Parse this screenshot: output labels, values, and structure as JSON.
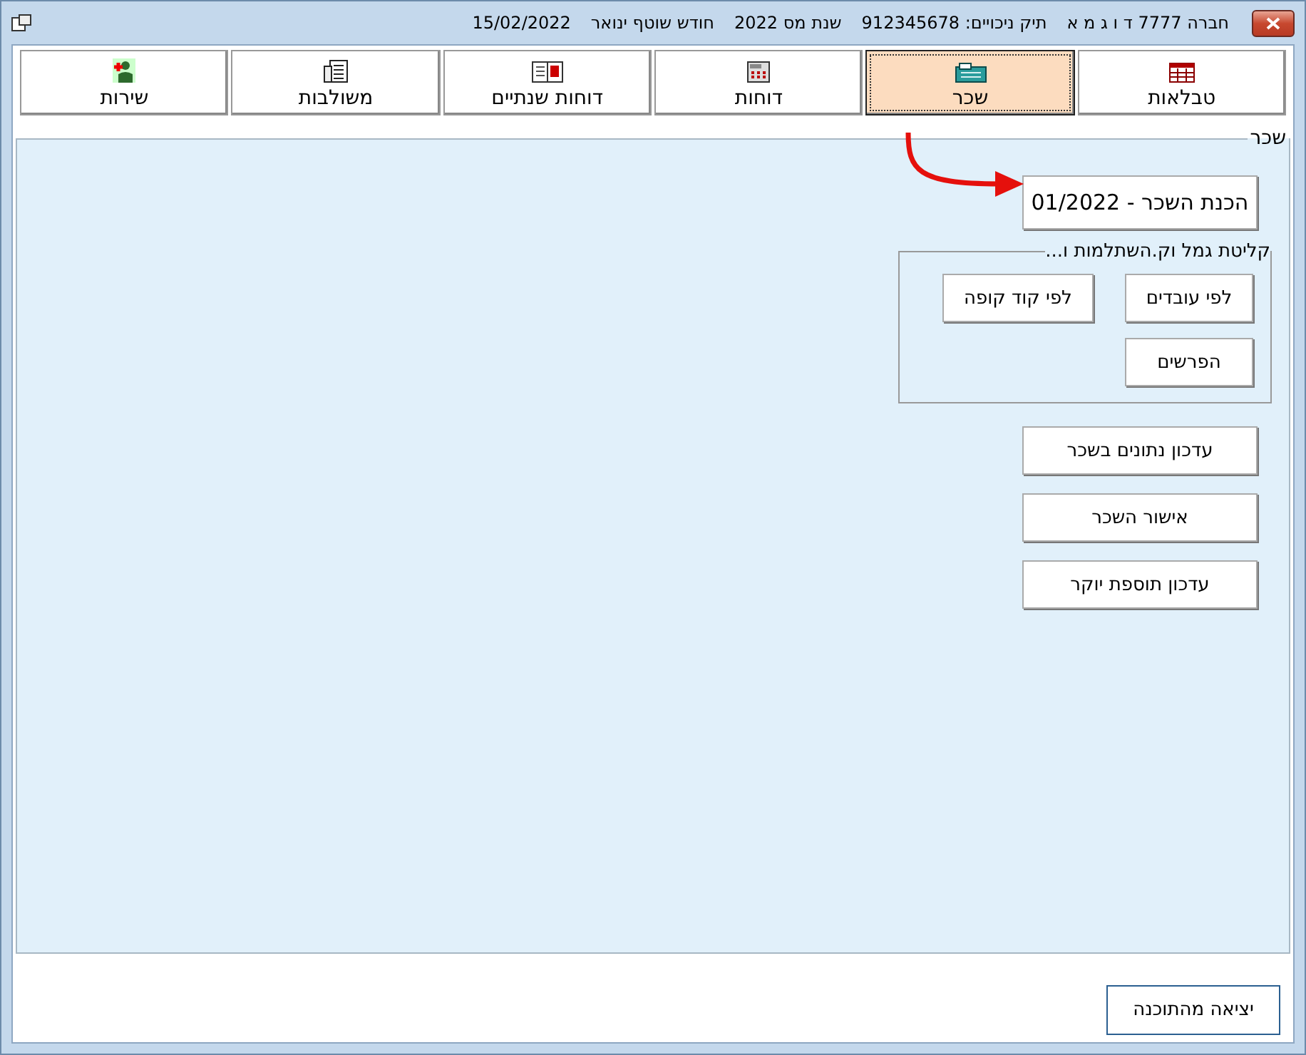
{
  "window": {
    "title_parts": [
      "חברה 7777 ד ו ג מ א",
      "תיק ניכויים: 912345678",
      "שנת מס 2022",
      "חודש שוטף ינואר",
      "15/02/2022"
    ]
  },
  "tabs": [
    {
      "label": "טבלאות",
      "kind": "table",
      "selected": false
    },
    {
      "label": "שכר",
      "kind": "register",
      "selected": true
    },
    {
      "label": "דוחות",
      "kind": "calculator",
      "selected": false
    },
    {
      "label": "דוחות שנתיים",
      "kind": "calendar",
      "selected": false
    },
    {
      "label": "משולבות",
      "kind": "document",
      "selected": false
    },
    {
      "label": "שירות",
      "kind": "person",
      "selected": false
    }
  ],
  "panel": {
    "title": "שכר",
    "primary_button": "הכנת השכר - 01/2022",
    "group": {
      "title": "קליטת גמל וק.השתלמות ו...",
      "buttons": [
        "לפי עובדים",
        "לפי קוד קופה",
        "הפרשים"
      ]
    },
    "buttons": [
      "עדכון נתונים בשכר",
      "אישור השכר",
      "עדכון תוספת יוקר"
    ]
  },
  "exit_button": "יציאה מהתוכנה"
}
